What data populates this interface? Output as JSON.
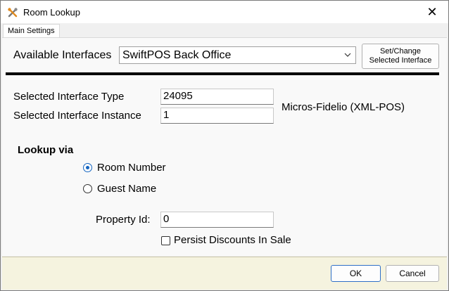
{
  "window": {
    "title": "Room Lookup",
    "close_glyph": "✕",
    "app_icon": "tools-icon"
  },
  "tabs": [
    {
      "label": "Main Settings",
      "selected": true
    }
  ],
  "interfaces": {
    "label": "Available Interfaces",
    "selected": "SwiftPOS Back Office",
    "set_change_button": "Set/Change\nSelected Interface"
  },
  "details": {
    "type_label": "Selected Interface Type",
    "type_value": "24095",
    "instance_label": "Selected Interface Instance",
    "instance_value": "1",
    "interface_name": "Micros-Fidelio (XML-POS)"
  },
  "lookup": {
    "heading": "Lookup via",
    "options": [
      {
        "label": "Room Number",
        "selected": true
      },
      {
        "label": "Guest Name",
        "selected": false
      }
    ]
  },
  "property": {
    "label": "Property Id:",
    "value": "0"
  },
  "persist": {
    "label": "Persist Discounts In Sale",
    "checked": false
  },
  "footer": {
    "ok": "OK",
    "cancel": "Cancel"
  },
  "colors": {
    "radio_accent": "#1565c0",
    "footer_bg": "#f5f3df",
    "ok_border": "#2e6fc7"
  }
}
